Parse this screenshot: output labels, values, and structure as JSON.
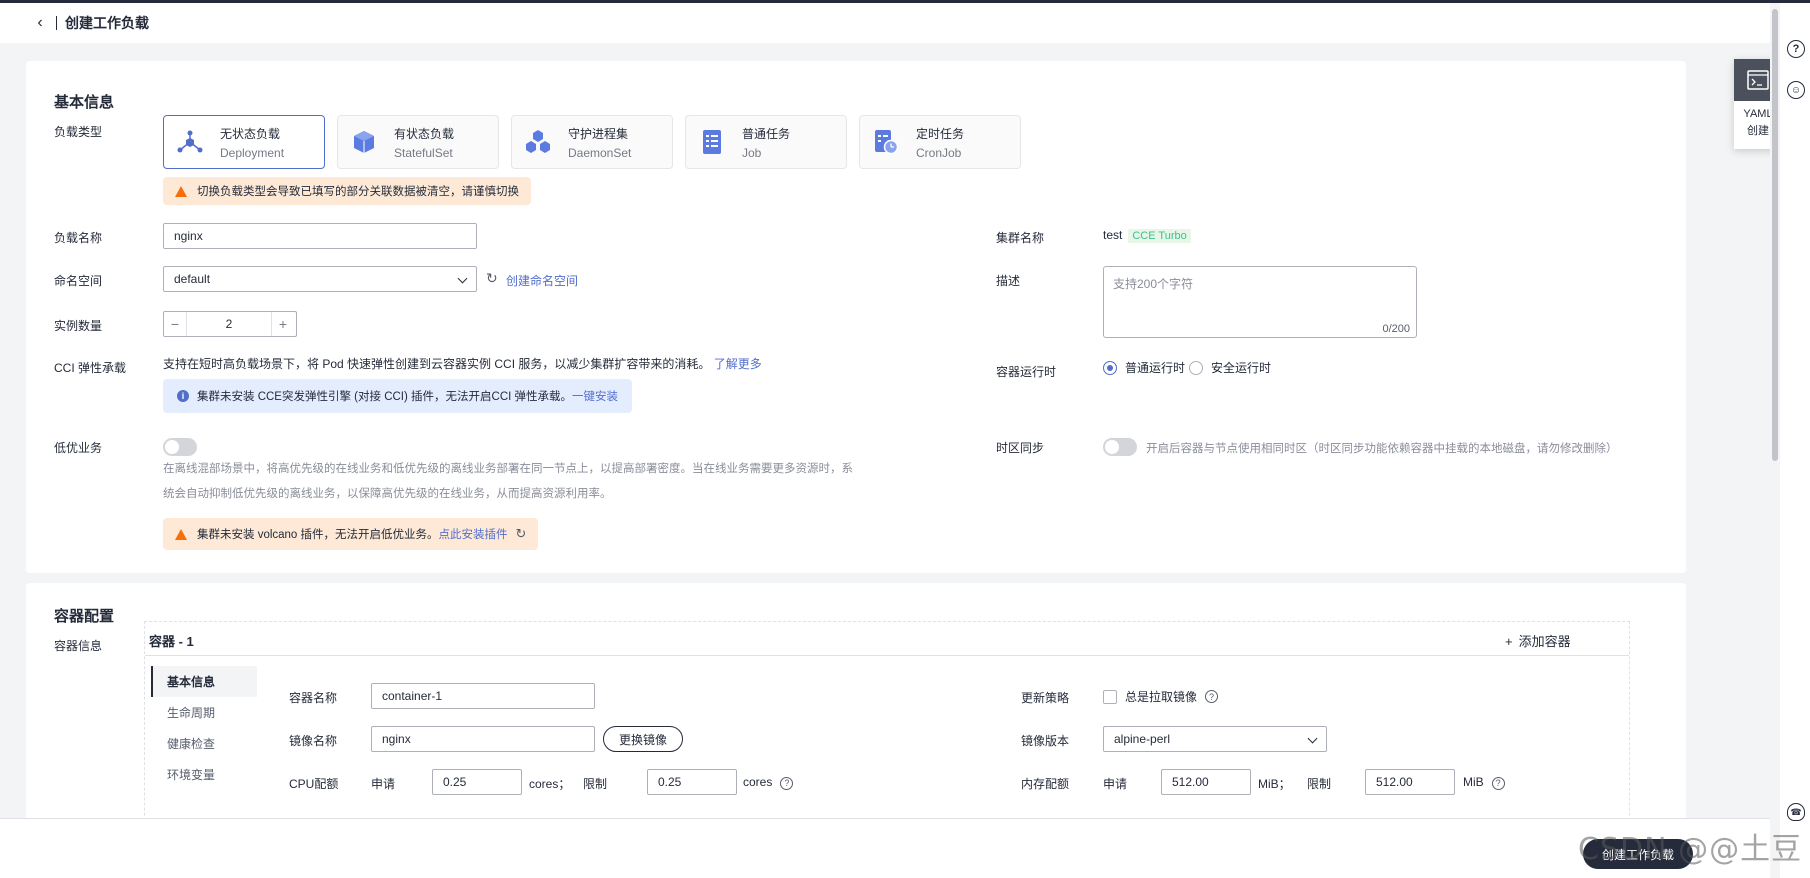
{
  "header": {
    "title": "创建工作负载"
  },
  "basic": {
    "section_title": "基本信息",
    "workload_type_label": "负载类型",
    "workload_types": [
      {
        "name": "无状态负载",
        "sub": "Deployment",
        "icon": "deployment-icon"
      },
      {
        "name": "有状态负载",
        "sub": "StatefulSet",
        "icon": "statefulset-icon"
      },
      {
        "name": "守护进程集",
        "sub": "DaemonSet",
        "icon": "daemonset-icon"
      },
      {
        "name": "普通任务",
        "sub": "Job",
        "icon": "job-icon"
      },
      {
        "name": "定时任务",
        "sub": "CronJob",
        "icon": "cronjob-icon"
      }
    ],
    "type_warning": "切换负载类型会导致已填写的部分关联数据被清空，请谨慎切换",
    "name_label": "负载名称",
    "name_value": "nginx",
    "namespace_label": "命名空间",
    "namespace_value": "default",
    "create_namespace": "创建命名空间",
    "replicas_label": "实例数量",
    "replicas_value": "2",
    "cci_label": "CCI 弹性承载",
    "cci_desc": "支持在短时高负载场景下，将 Pod 快速弹性创建到云容器实例 CCI 服务，以减少集群扩容带来的消耗。",
    "cci_learn_more": "了解更多",
    "cci_info": "集群未安装 CCE突发弹性引擎 (对接 CCI) 插件，无法开启CCI 弹性承载。",
    "cci_install": "一键安装",
    "low_priority_label": "低优业务",
    "low_priority_desc_1": "在离线混部场景中，将高优先级的在线业务和低优先级的离线业务部署在同一节点上，以提高部署密度。当在线业务需要更多资源时，系",
    "low_priority_desc_2": "统会自动抑制低优先级的离线业务，以保障高优先级的在线业务，从而提高资源利用率。",
    "volcano_warning": "集群未安装 volcano 插件，无法开启低优业务。",
    "volcano_install": "点此安装插件",
    "cluster_label": "集群名称",
    "cluster_value": "test",
    "cluster_tag": "CCE Turbo",
    "desc_label": "描述",
    "desc_placeholder": "支持200个字符",
    "desc_counter": "0/200",
    "runtime_label": "容器运行时",
    "runtime_options": [
      "普通运行时",
      "安全运行时"
    ],
    "tz_label": "时区同步",
    "tz_desc": "开启后容器与节点使用相同时区（时区同步功能依赖容器中挂载的本地磁盘，请勿修改删除）"
  },
  "container": {
    "section_title": "容器配置",
    "info_label": "容器信息",
    "container_title": "容器 - 1",
    "add_container": "添加容器",
    "nav": [
      "基本信息",
      "生命周期",
      "健康检查",
      "环境变量"
    ],
    "name_label": "容器名称",
    "name_value": "container-1",
    "image_label": "镜像名称",
    "image_value": "nginx",
    "change_image": "更换镜像",
    "cpu_label": "CPU配额",
    "request": "申请",
    "limit": "限制",
    "cpu_request": "0.25",
    "cpu_limit": "0.25",
    "cpu_unit_semicolon": "cores；",
    "cpu_unit": "cores",
    "update_policy_label": "更新策略",
    "always_pull": "总是拉取镜像",
    "image_version_label": "镜像版本",
    "image_version_value": "alpine-perl",
    "mem_label": "内存配额",
    "mem_request": "512.00",
    "mem_limit": "512.00",
    "mem_unit_semicolon": "MiB；",
    "mem_unit": "MiB"
  },
  "yaml": {
    "line1": "YAML",
    "line2": "创建"
  },
  "footer": {
    "submit": "创建工作负载",
    "watermark": "CSDN @@土豆"
  }
}
